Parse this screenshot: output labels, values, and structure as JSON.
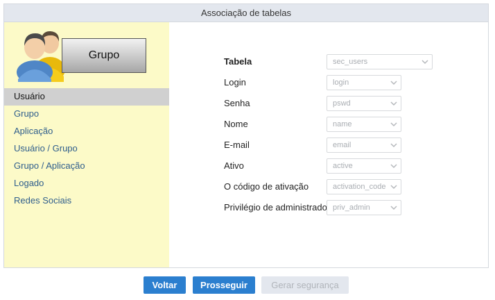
{
  "header": {
    "title": "Associação de tabelas"
  },
  "sidebar": {
    "hero_label": "Grupo",
    "hero_icon": "users-icon",
    "items": [
      {
        "label": "Usuário",
        "active": true
      },
      {
        "label": "Grupo"
      },
      {
        "label": "Aplicação"
      },
      {
        "label": "Usuário / Grupo"
      },
      {
        "label": "Grupo / Aplicação"
      },
      {
        "label": "Logado"
      },
      {
        "label": "Redes Sociais"
      }
    ]
  },
  "form": {
    "fields": [
      {
        "label": "Tabela",
        "value": "sec_users"
      },
      {
        "label": "Login",
        "value": "login"
      },
      {
        "label": "Senha",
        "value": "pswd"
      },
      {
        "label": "Nome",
        "value": "name"
      },
      {
        "label": "E-mail",
        "value": "email"
      },
      {
        "label": "Ativo",
        "value": "active"
      },
      {
        "label": "O código de ativação",
        "value": "activation_code"
      },
      {
        "label": "Privilégio de administrador",
        "value": "priv_admin"
      }
    ]
  },
  "buttons": {
    "back": "Voltar",
    "next": "Prosseguir",
    "generate": "Gerar segurança"
  },
  "colors": {
    "accent": "#2b7fcf",
    "sidebar_bg": "#fcfac8",
    "header_bg": "#e3e7ee",
    "active_item_bg": "#d0d0d0",
    "disabled_bg": "#e3e7ee"
  }
}
